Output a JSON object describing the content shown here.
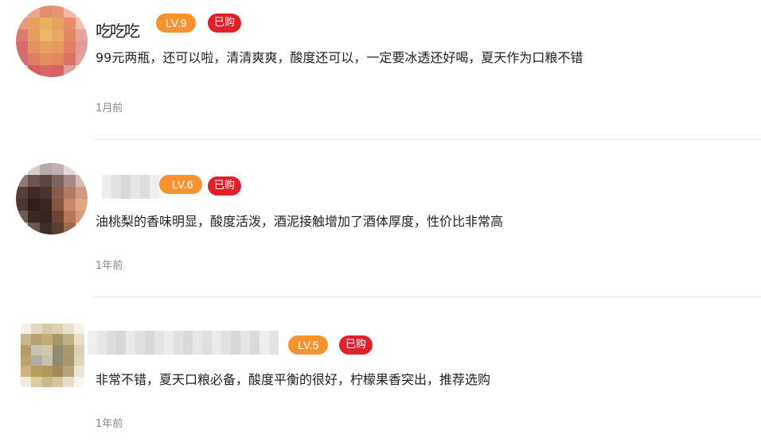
{
  "colors": {
    "level_badge": "#f7922e",
    "bought_badge": "#e0202b",
    "divider": "#e8e8e8"
  },
  "reviews": [
    {
      "username": "吃吃吃",
      "level": "LV.9",
      "bought": "已购",
      "content": "99元两瓶，还可以啦，清清爽爽，酸度还可以，一定要冰透还好喝，夏天作为口粮不错",
      "time": "1月前"
    },
    {
      "username": "",
      "level": "LV.6",
      "bought": "已购",
      "content": "油桃梨的香味明显，酸度活泼，酒泥接触增加了酒体厚度，性价比非常高",
      "time": "1年前"
    },
    {
      "username": "",
      "level": "LV.5",
      "bought": "已购",
      "content": "非常不错，夏天口粮必备，酸度平衡的很好，柠檬果香突出，推荐选购",
      "time": "1年前"
    }
  ]
}
